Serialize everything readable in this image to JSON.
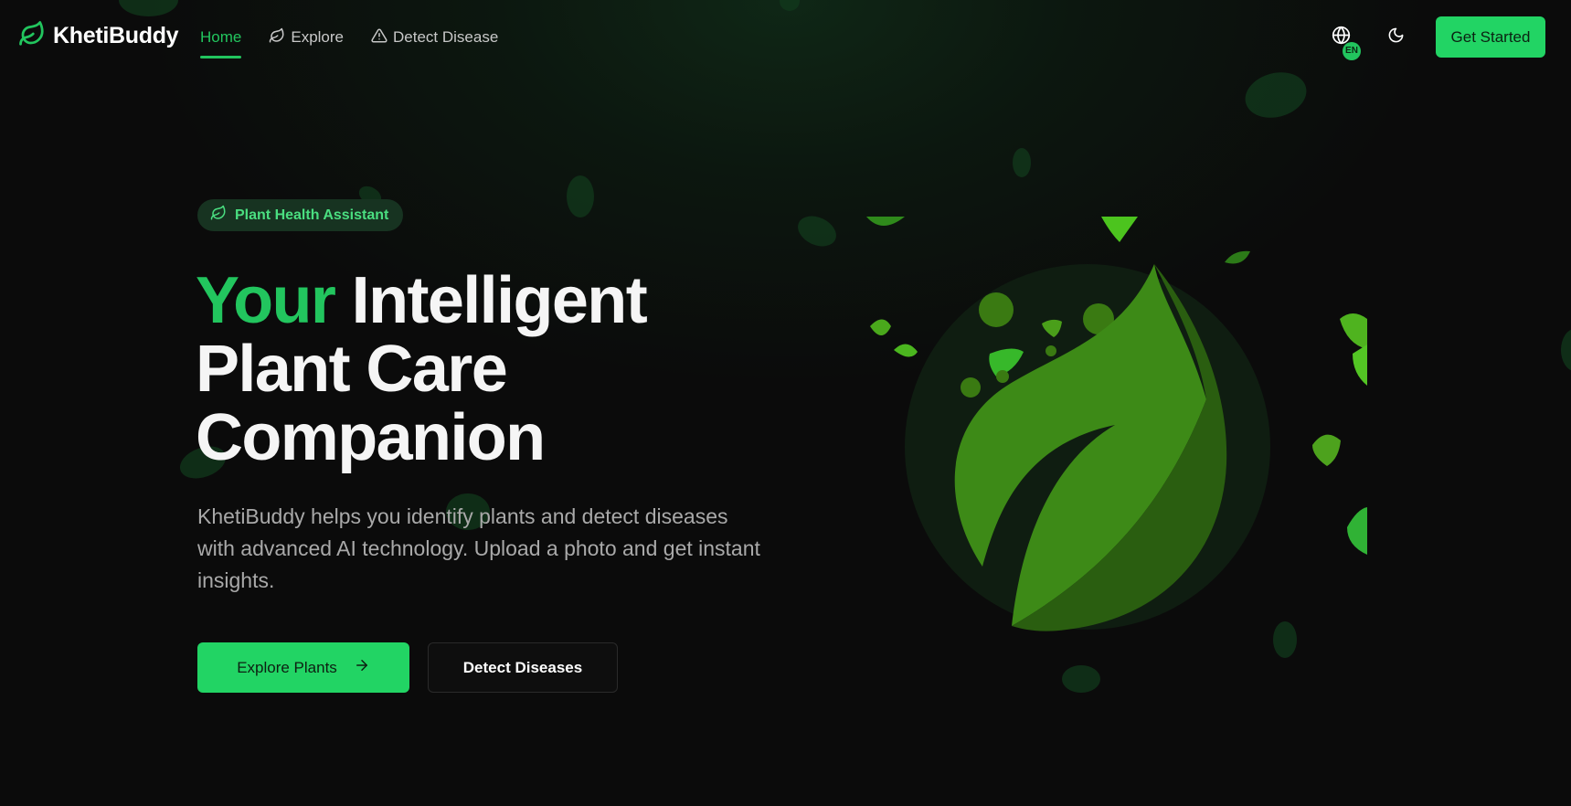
{
  "brand": {
    "name": "KhetiBuddy",
    "logo_icon": "leaf-icon",
    "accent": "#22c55e"
  },
  "nav": {
    "links": [
      {
        "label": "Home",
        "icon": "",
        "active": true
      },
      {
        "label": "Explore",
        "icon": "leaf-icon",
        "active": false
      },
      {
        "label": "Detect Disease",
        "icon": "alert-triangle-icon",
        "active": false
      }
    ],
    "language_badge": "EN",
    "language_icon": "globe-icon",
    "theme_icon": "moon-icon",
    "cta_label": "Get Started"
  },
  "hero": {
    "pill_label": "Plant Health Assistant",
    "pill_icon": "leaf-icon",
    "headline_accent": "Your",
    "headline_line1_rest": " Intelligent",
    "headline_line2": "Plant Care",
    "headline_line3": "Companion",
    "subtitle": "KhetiBuddy helps you identify plants and detect diseases with advanced AI technology. Upload a photo and get instant insights.",
    "primary_button": "Explore Plants",
    "primary_button_icon": "arrow-right-icon",
    "secondary_button": "Detect Diseases"
  },
  "colors": {
    "background": "#0b0b0b",
    "primary": "#22d464",
    "leaf_light": "#3d8a17",
    "leaf_dark": "#2a5e10"
  }
}
